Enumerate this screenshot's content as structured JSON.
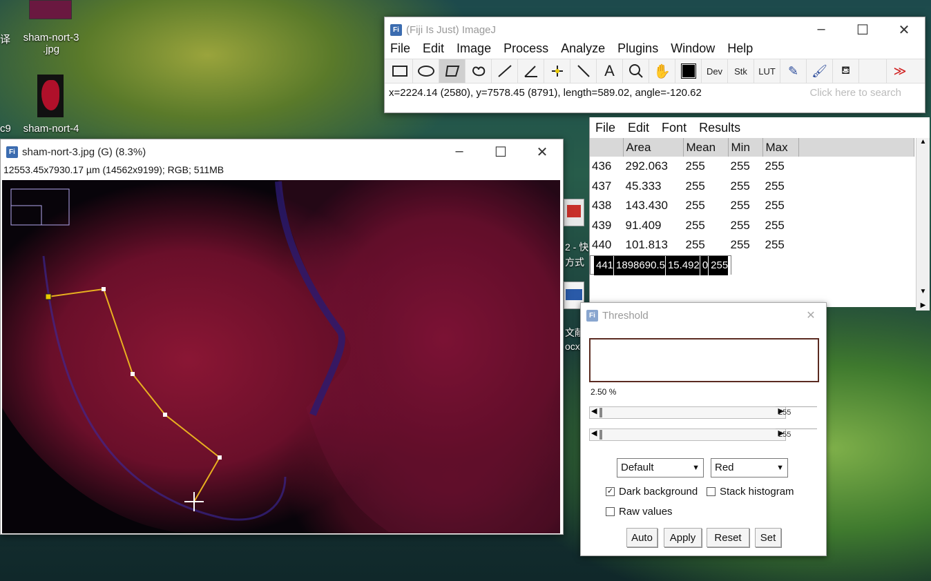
{
  "desktop": {
    "icons": [
      {
        "label": "sham-nort-3\n.jpg"
      },
      {
        "label": "sham-nort-4"
      }
    ],
    "fragments": [
      "译",
      "c9",
      "2 - 快",
      "方式",
      "文献",
      "ocx"
    ]
  },
  "imagej": {
    "title": "(Fiji Is Just) ImageJ",
    "menu": [
      "File",
      "Edit",
      "Image",
      "Process",
      "Analyze",
      "Plugins",
      "Window",
      "Help"
    ],
    "tools": [
      "rectangle-tool",
      "oval-tool",
      "polygon-tool",
      "freehand-tool",
      "line-tool",
      "angle-tool",
      "point-tool",
      "wand-tool",
      "text-tool",
      "magnifier-tool",
      "hand-tool",
      "color-picker-tool",
      "Dev",
      "Stk",
      "LUT",
      "pencil-tool",
      "brush-tool",
      "flood-fill-tool",
      "more-tools"
    ],
    "status": "x=2224.14 (2580), y=7578.45 (8791), length=589.02, angle=-120.62",
    "search_placeholder": "Click here to search"
  },
  "image_window": {
    "title": "sham-nort-3.jpg (G) (8.3%)",
    "info": "12553.45x7930.17 µm (14562x9199); RGB; 511MB"
  },
  "results": {
    "menu": [
      "File",
      "Edit",
      "Font",
      "Results"
    ],
    "columns": [
      "",
      "Area",
      "Mean",
      "Min",
      "Max"
    ],
    "rows": [
      [
        "436",
        "292.063",
        "255",
        "255",
        "255"
      ],
      [
        "437",
        "45.333",
        "255",
        "255",
        "255"
      ],
      [
        "438",
        "143.430",
        "255",
        "255",
        "255"
      ],
      [
        "439",
        "91.409",
        "255",
        "255",
        "255"
      ],
      [
        "440",
        "101.813",
        "255",
        "255",
        "255"
      ],
      [
        "441",
        "1898690.5",
        "15.492",
        "0",
        "255"
      ]
    ]
  },
  "threshold": {
    "title": "Threshold",
    "percent": "2.50 %",
    "slider1": "255",
    "slider2": "255",
    "method": "Default",
    "mode": "Red",
    "dark_background": "Dark background",
    "stack_histogram": "Stack histogram",
    "raw_values": "Raw values",
    "buttons": {
      "auto": "Auto",
      "apply": "Apply",
      "reset": "Reset",
      "set": "Set"
    }
  }
}
